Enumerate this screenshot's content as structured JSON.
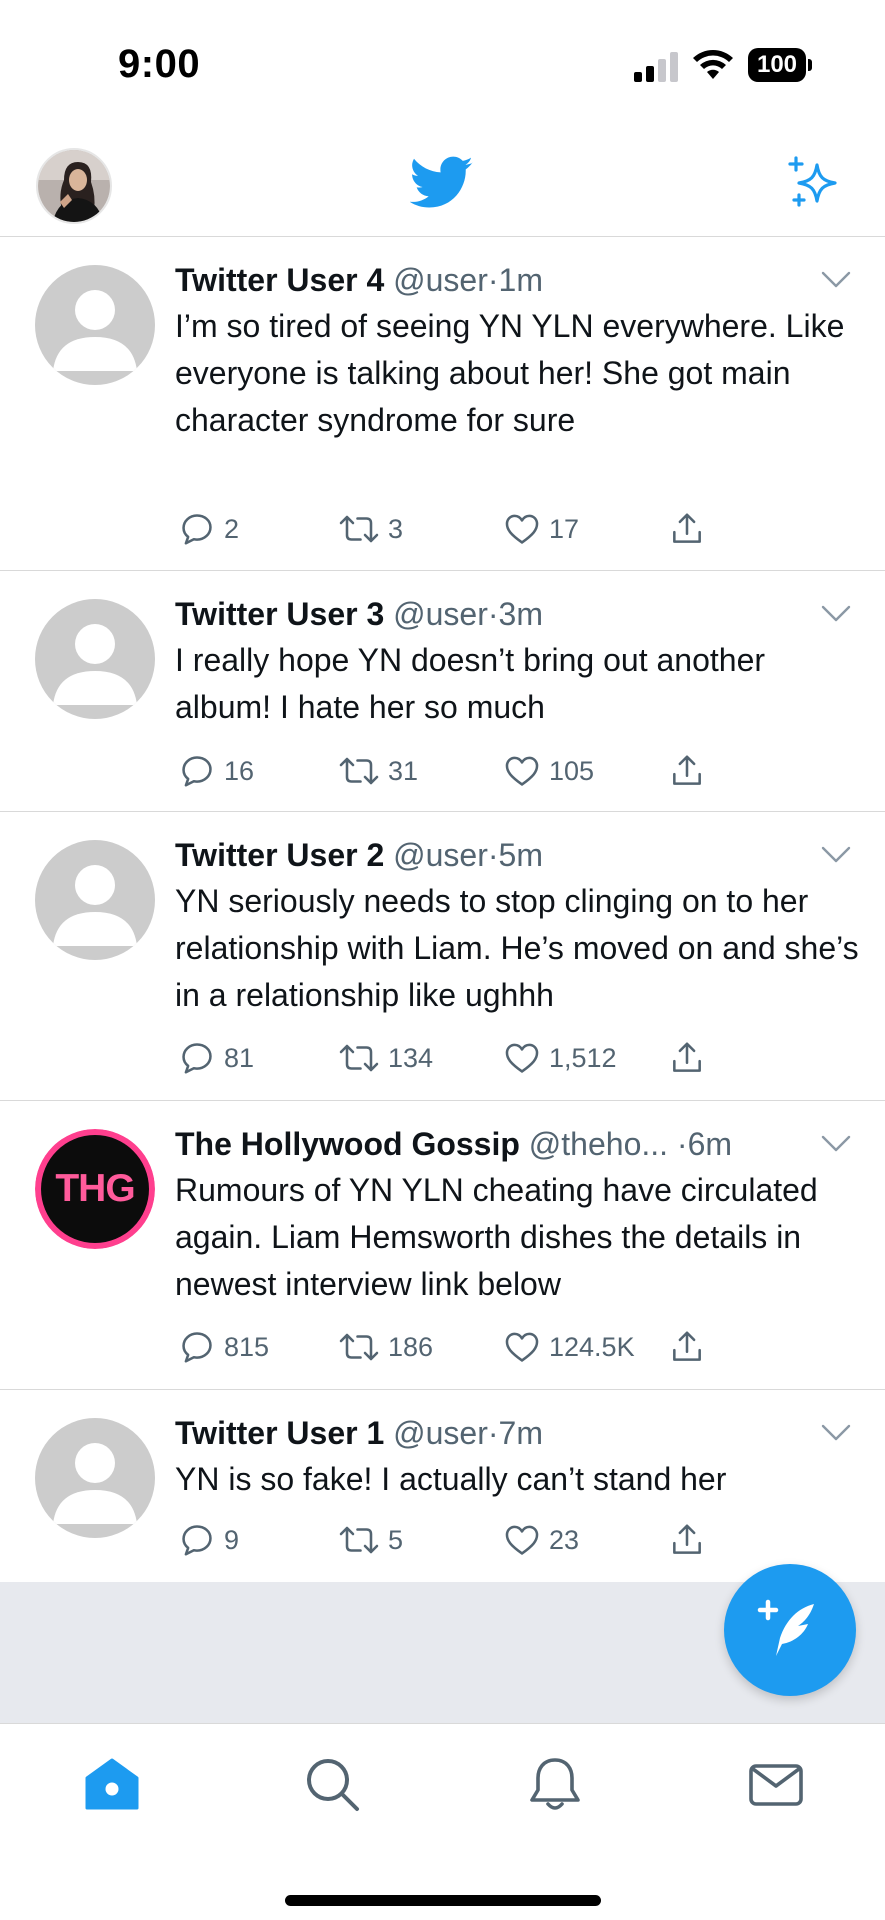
{
  "status_bar": {
    "time": "9:00",
    "battery": "100"
  },
  "icons": {
    "header": [
      "profile-avatar",
      "twitter-bird-icon",
      "sparkle-icon"
    ],
    "tweet_actions": [
      "reply-icon",
      "retweet-icon",
      "like-icon",
      "share-icon"
    ],
    "bottom_nav": [
      "home-icon",
      "search-icon",
      "bell-icon",
      "mail-icon"
    ],
    "fab": "compose-icon"
  },
  "colors": {
    "brand": "#1d9bf0",
    "muted_text": "#536471",
    "thg_pink": "#ff3f8e"
  },
  "tweets": [
    {
      "name": "Twitter User 4",
      "handle": "@user",
      "dot": "·",
      "time": "1m",
      "text": "I’m so tired of seeing YN YLN everywhere. Like everyone is talking about her! She got main character syndrome for sure",
      "replies": "2",
      "retweets": "3",
      "likes": "17"
    },
    {
      "name": "Twitter User 3",
      "handle": "@user",
      "dot": "·",
      "time": "3m",
      "text": "I really hope YN doesn’t bring out another album! I hate her so much",
      "replies": "16",
      "retweets": "31",
      "likes": "105"
    },
    {
      "name": "Twitter User 2",
      "handle": "@user",
      "dot": "·",
      "time": "5m",
      "text": "YN seriously needs to stop clinging on to her relationship with Liam. He’s moved on and she’s in a relationship like ughhh",
      "replies": "81",
      "retweets": "134",
      "likes": "1,512"
    },
    {
      "name": "The Hollywood Gossip",
      "handle": "@theho...",
      "dot": " ·",
      "time": "6m",
      "avatar_text": "THG",
      "text": "Rumours of YN YLN cheating have circulated again. Liam Hemsworth dishes the details in newest interview link below",
      "replies": "815",
      "retweets": "186",
      "likes": "124.5K"
    },
    {
      "name": "Twitter User 1",
      "handle": "@user",
      "dot": "·",
      "time": "7m",
      "text": "YN is so fake! I actually can’t stand her",
      "replies": "9",
      "retweets": "5",
      "likes": "23"
    }
  ]
}
